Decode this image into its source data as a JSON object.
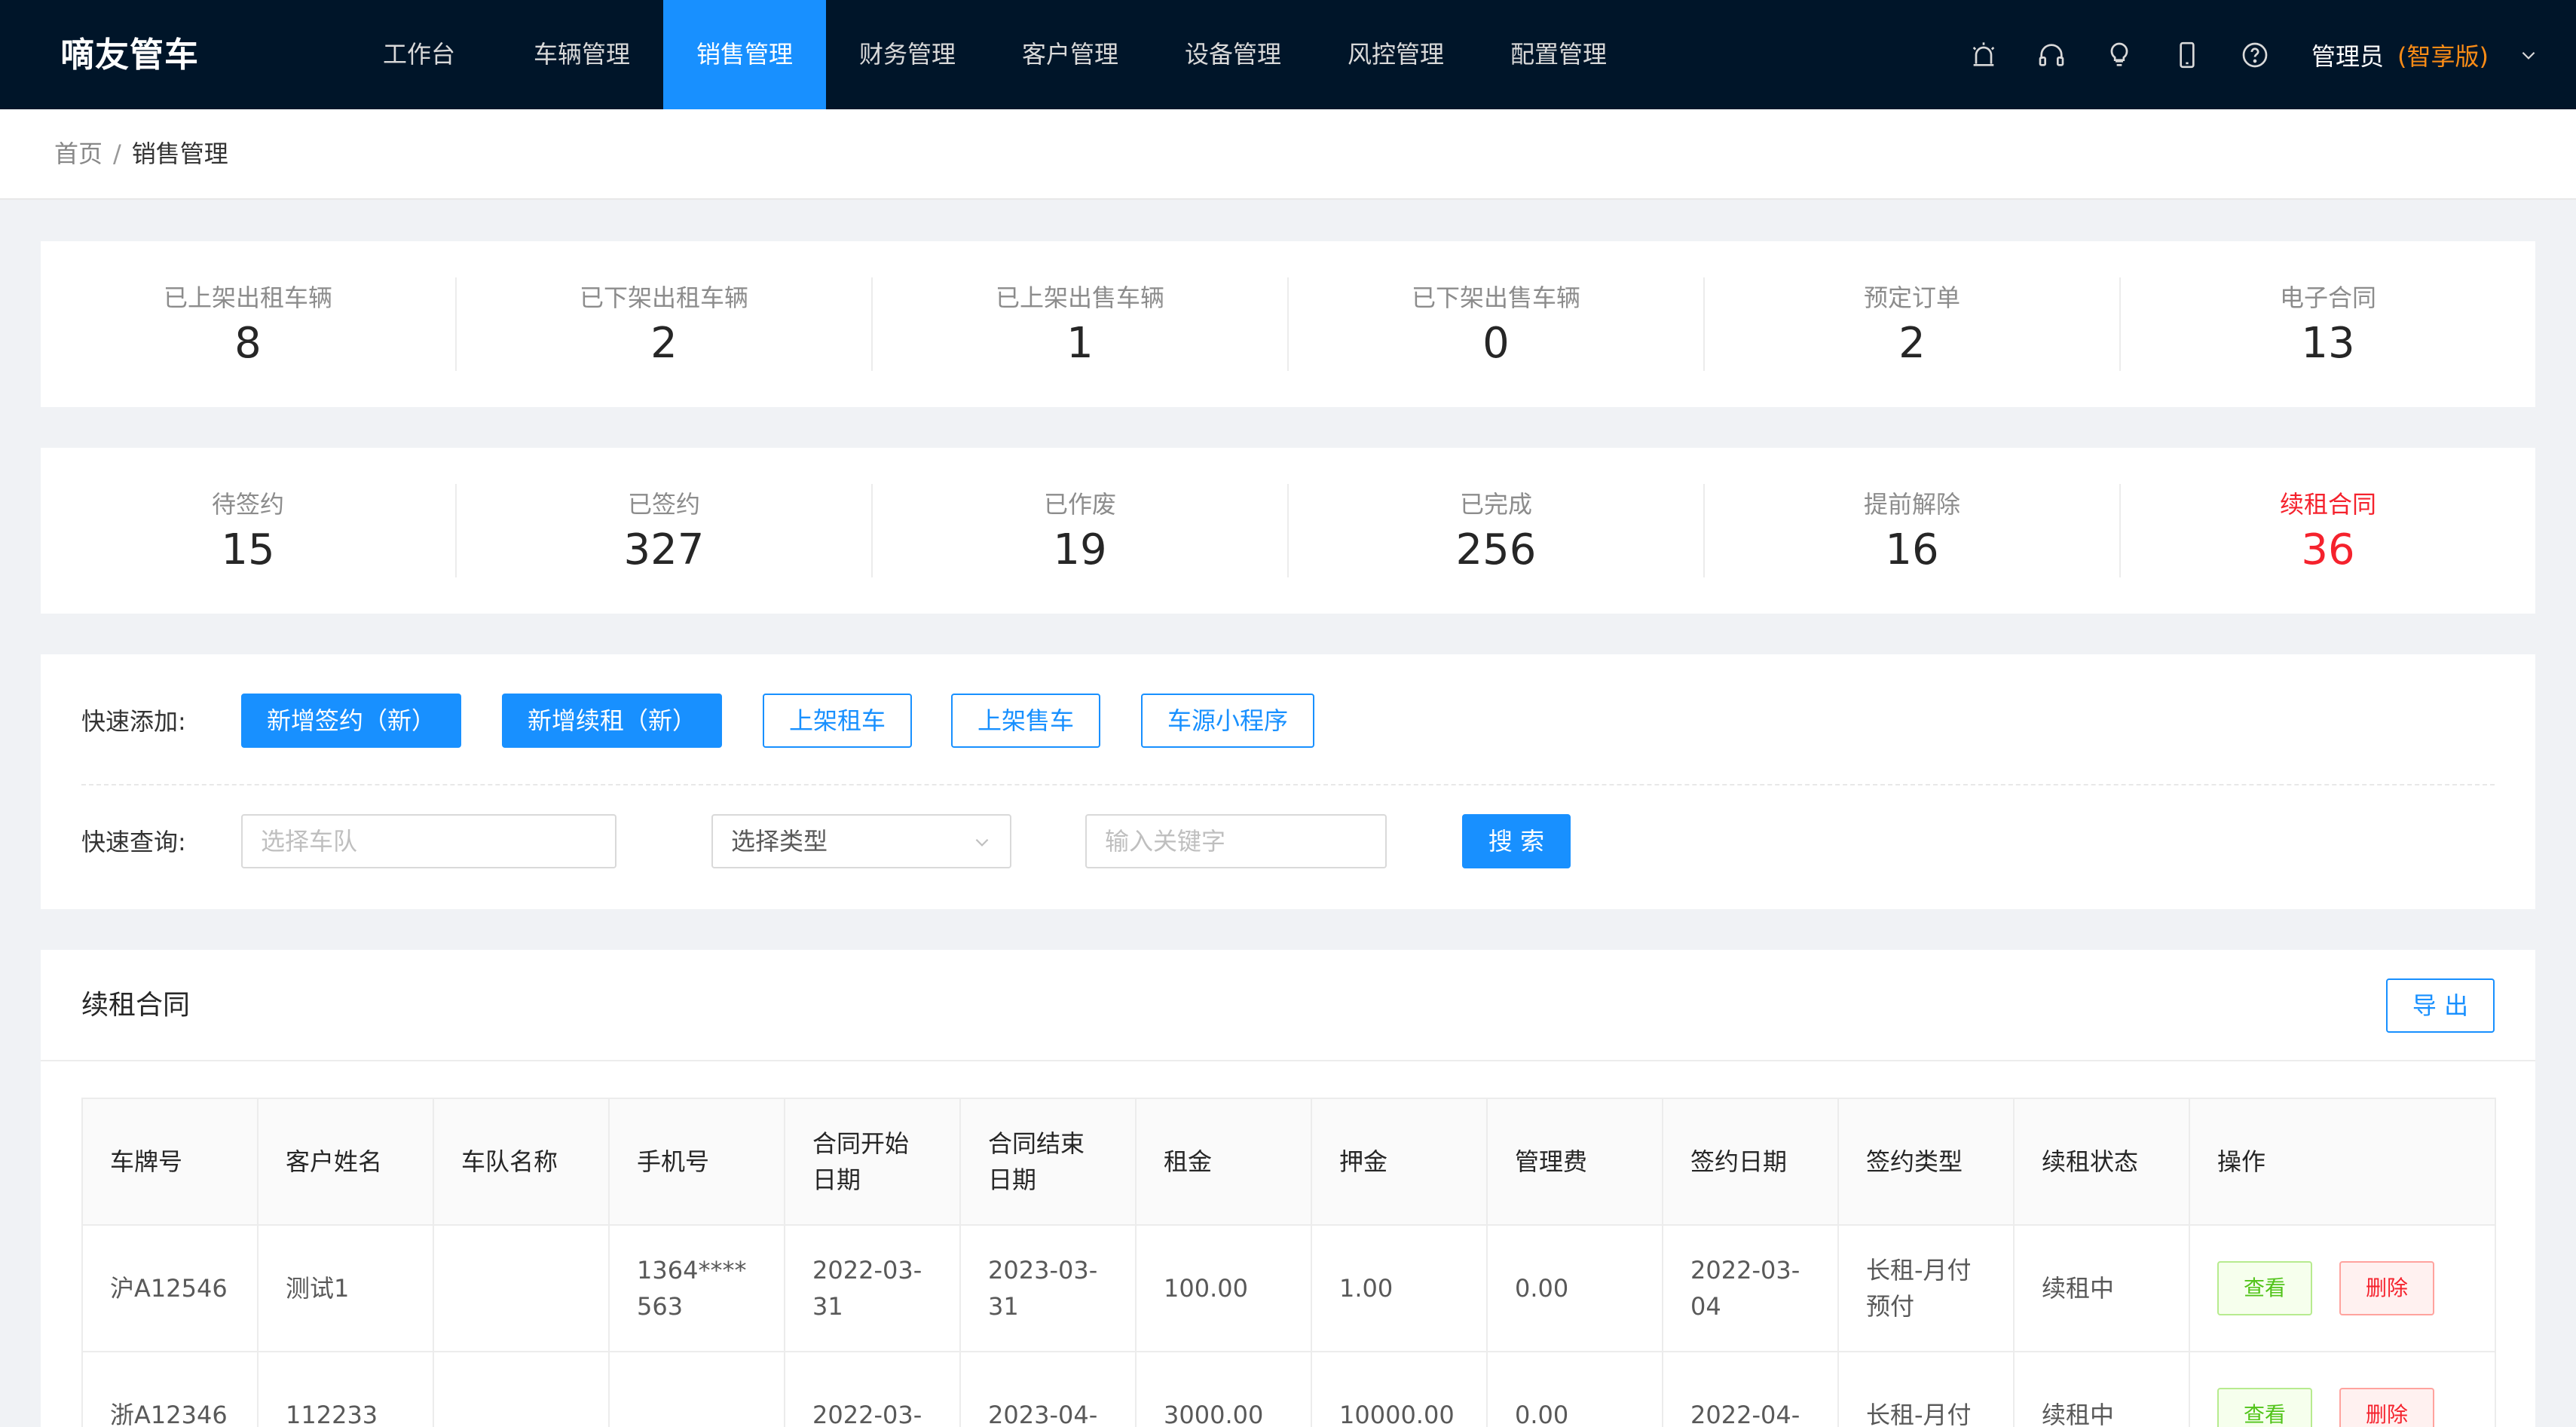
{
  "app": {
    "brand": "嘀友管车"
  },
  "nav": {
    "items": [
      {
        "label": "工作台"
      },
      {
        "label": "车辆管理"
      },
      {
        "label": "销售管理",
        "active": true
      },
      {
        "label": "财务管理"
      },
      {
        "label": "客户管理"
      },
      {
        "label": "设备管理"
      },
      {
        "label": "风控管理"
      },
      {
        "label": "配置管理"
      }
    ],
    "tools": [
      "alarm-icon",
      "headset-icon",
      "lightbulb-icon",
      "mobile-icon",
      "help-icon"
    ],
    "user": {
      "name": "管理员",
      "version": "(智享版)"
    }
  },
  "breadcrumb": {
    "home": "首页",
    "separator": "/",
    "current": "销售管理"
  },
  "stats_row1": [
    {
      "label": "已上架出租车辆",
      "value": "8"
    },
    {
      "label": "已下架出租车辆",
      "value": "2"
    },
    {
      "label": "已上架出售车辆",
      "value": "1"
    },
    {
      "label": "已下架出售车辆",
      "value": "0"
    },
    {
      "label": "预定订单",
      "value": "2"
    },
    {
      "label": "电子合同",
      "value": "13"
    }
  ],
  "stats_row2": [
    {
      "label": "待签约",
      "value": "15"
    },
    {
      "label": "已签约",
      "value": "327"
    },
    {
      "label": "已作废",
      "value": "19"
    },
    {
      "label": "已完成",
      "value": "256"
    },
    {
      "label": "提前解除",
      "value": "16"
    },
    {
      "label": "续租合同",
      "value": "36",
      "highlight": "#f5222d"
    }
  ],
  "quick_add": {
    "label": "快速添加:",
    "buttons": [
      "新增签约（新）",
      "新增续租（新）",
      "上架租车",
      "上架售车",
      "车源小程序"
    ]
  },
  "quick_query": {
    "label": "快速查询:",
    "fleet_placeholder": "选择车队",
    "type_value": "选择类型",
    "keyword_placeholder": "输入关键字",
    "search_label": "搜 索"
  },
  "section": {
    "title": "续租合同",
    "export_label": "导 出"
  },
  "table": {
    "headers": [
      "车牌号",
      "客户姓名",
      "车队名称",
      "手机号",
      "合同开始日期",
      "合同结束日期",
      "租金",
      "押金",
      "管理费",
      "签约日期",
      "签约类型",
      "续租状态",
      "操作"
    ],
    "rows": [
      [
        "沪A12546",
        "测试1",
        "",
        "1364****563",
        "2022-03-31",
        "2023-03-31",
        "100.00",
        "1.00",
        "0.00",
        "2022-03-04",
        "长租-月付预付",
        "续租中"
      ],
      [
        "浙A12346",
        "112233",
        "",
        "",
        "2022-03-",
        "2023-04-",
        "3000.00",
        "10000.00",
        "0.00",
        "2022-04-",
        "长租-月付",
        "续租中"
      ]
    ],
    "view_label": "查看",
    "delete_label": "删除"
  },
  "colors": {
    "nav_bg": "#001529",
    "primary": "#1890ff",
    "danger": "#f5222d",
    "warning": "#fa8c16",
    "success": "#52c41a"
  }
}
